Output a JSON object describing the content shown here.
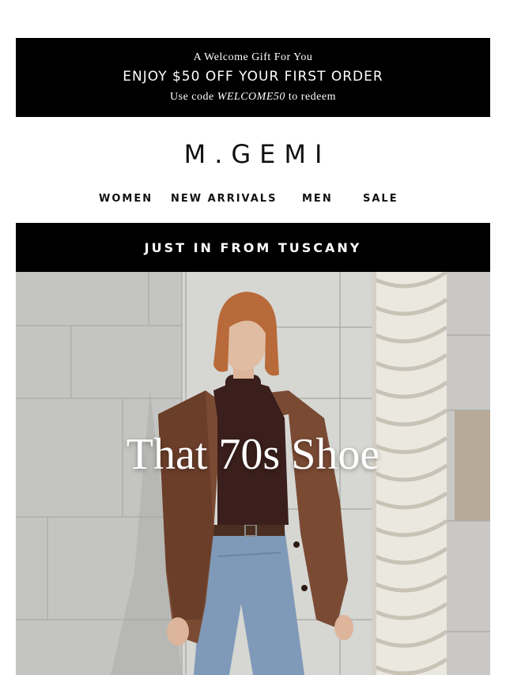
{
  "promo": {
    "eyebrow": "A Welcome Gift For You",
    "headline": "ENJOY $50 OFF YOUR FIRST ORDER",
    "code_prefix": "Use code ",
    "code": "WELCOME50",
    "code_suffix": " to redeem"
  },
  "brand": {
    "logo_text": "M.GEMI"
  },
  "nav": {
    "items": [
      {
        "label": "WOMEN"
      },
      {
        "label": "NEW ARRIVALS"
      },
      {
        "label": "MEN"
      },
      {
        "label": "SALE"
      }
    ]
  },
  "banner": {
    "label": "JUST IN FROM TUSCANY"
  },
  "hero": {
    "title": "That 70s Shoe"
  }
}
